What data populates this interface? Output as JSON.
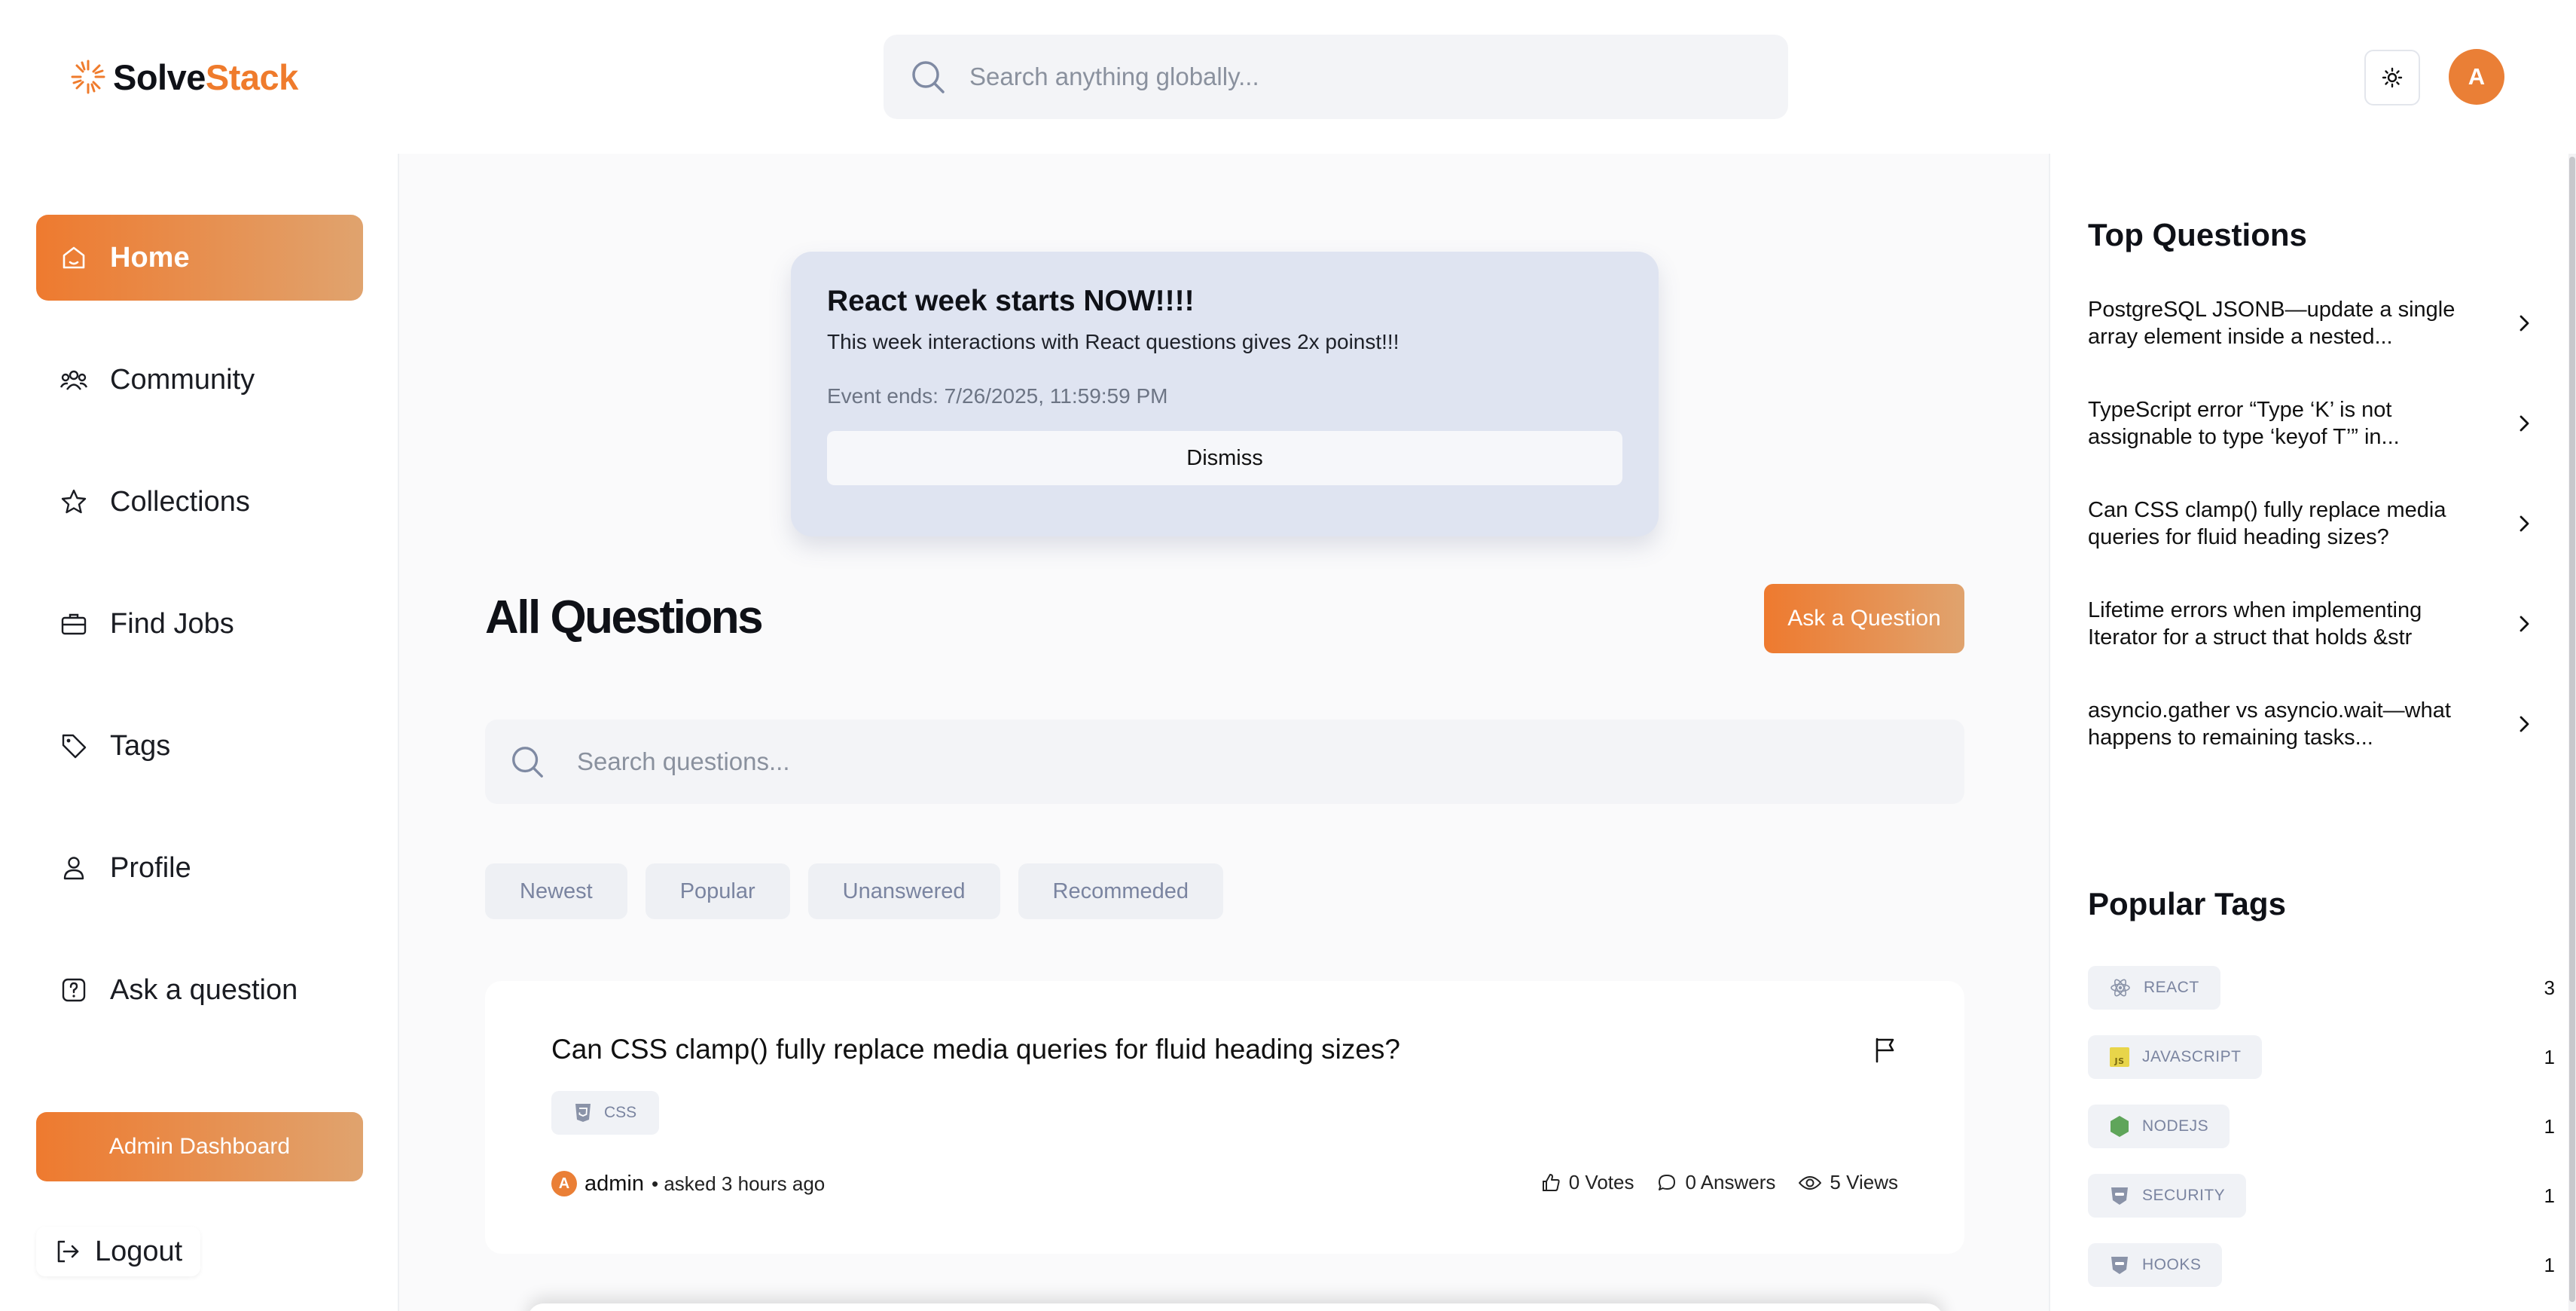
{
  "header": {
    "logo_text_a": "Solve",
    "logo_text_b": "Stack",
    "search_placeholder": "Search anything globally...",
    "avatar_initial": "A"
  },
  "sidebar": {
    "items": [
      {
        "label": "Home",
        "icon": "home-icon",
        "active": true
      },
      {
        "label": "Community",
        "icon": "users-icon",
        "active": false
      },
      {
        "label": "Collections",
        "icon": "star-icon",
        "active": false
      },
      {
        "label": "Find Jobs",
        "icon": "briefcase-icon",
        "active": false
      },
      {
        "label": "Tags",
        "icon": "tag-icon",
        "active": false
      },
      {
        "label": "Profile",
        "icon": "user-icon",
        "active": false
      },
      {
        "label": "Ask a question",
        "icon": "question-icon",
        "active": false
      }
    ],
    "admin_label": "Admin Dashboard",
    "logout_label": "Logout"
  },
  "banner": {
    "title": "React week starts NOW!!!!",
    "description": "This week interactions with React questions gives 2x poinst!!!",
    "ends": "Event ends: 7/26/2025, 11:59:59 PM",
    "dismiss_label": "Dismiss"
  },
  "main": {
    "title": "All Questions",
    "ask_label": "Ask a Question",
    "search_placeholder": "Search questions...",
    "filters": [
      "Newest",
      "Popular",
      "Unanswered",
      "Recommeded"
    ]
  },
  "questions": [
    {
      "title": "Can CSS clamp() fully replace media queries for fluid heading sizes?",
      "tag": "CSS",
      "author_initial": "A",
      "author": "admin",
      "asked": "• asked 3 hours ago",
      "votes": "0 Votes",
      "answers": "0 Answers",
      "views": "5 Views"
    }
  ],
  "right": {
    "top_title": "Top Questions",
    "top_questions": [
      "PostgreSQL JSONB—update a single array element inside a nested...",
      "TypeScript error “Type ‘K’ is not assignable to type ‘keyof T’” in...",
      "Can CSS clamp() fully replace media queries for fluid heading sizes?",
      "Lifetime errors when implementing Iterator for a struct that holds &str",
      "asyncio.gather vs asyncio.wait—what happens to remaining tasks..."
    ],
    "tags_title": "Popular Tags",
    "tags": [
      {
        "name": "REACT",
        "count": "3",
        "icon": "react-icon"
      },
      {
        "name": "JAVASCRIPT",
        "count": "1",
        "icon": "javascript-icon"
      },
      {
        "name": "NODEJS",
        "count": "1",
        "icon": "nodejs-icon"
      },
      {
        "name": "SECURITY",
        "count": "1",
        "icon": "shield-icon"
      },
      {
        "name": "HOOKS",
        "count": "1",
        "icon": "shield-icon"
      }
    ]
  },
  "colors": {
    "accent": "#ee7a2f",
    "accent_light": "#e0a36e",
    "banner_bg": "#dfe4f1"
  }
}
